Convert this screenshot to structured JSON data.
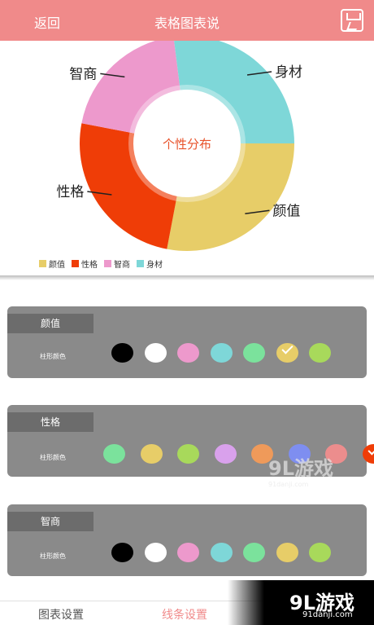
{
  "topbar": {
    "back_label": "返回",
    "title": "表格图表说",
    "save_icon": "save-chart-icon"
  },
  "chart_data": {
    "type": "pie",
    "center_label": "个性分布",
    "categories": [
      "颜值",
      "性格",
      "智商",
      "身材"
    ],
    "values": [
      28,
      25,
      20,
      27
    ],
    "colors": [
      "#e7cd68",
      "#ef3d07",
      "#ed99cc",
      "#7ed7d8"
    ],
    "callouts": [
      "颜值",
      "性格",
      "智商",
      "身材"
    ],
    "legend": [
      "颜值",
      "性格",
      "智商",
      "身材"
    ],
    "legend_position": "bottom-left"
  },
  "panels": [
    {
      "label": "颜值",
      "row_label": "柱形颜色",
      "colors": [
        "#000000",
        "#ffffff",
        "#ed99cc",
        "#7ed7d8",
        "#7be29c",
        "#e7cd68",
        "#a8d95b"
      ],
      "selected_index": 5
    },
    {
      "label": "性格",
      "row_label": "柱形颜色",
      "colors": [
        "#7be29c",
        "#e7cd68",
        "#a8d95b",
        "#d9a1ec",
        "#ef9a5a",
        "#7e8ef0",
        "#ec8d8d",
        "#ef3d07"
      ],
      "selected_index": 7
    },
    {
      "label": "智商",
      "row_label": "柱形颜色",
      "colors": [
        "#000000",
        "#ffffff",
        "#ed99cc",
        "#7ed7d8",
        "#7be29c",
        "#e7cd68",
        "#a8d95b"
      ],
      "selected_index": -1
    }
  ],
  "watermark": {
    "text": "9L游戏",
    "site": "91danji.com"
  },
  "bottom_tabs": [
    "图表设置",
    "线条设置"
  ],
  "active_tab": "线条设置"
}
